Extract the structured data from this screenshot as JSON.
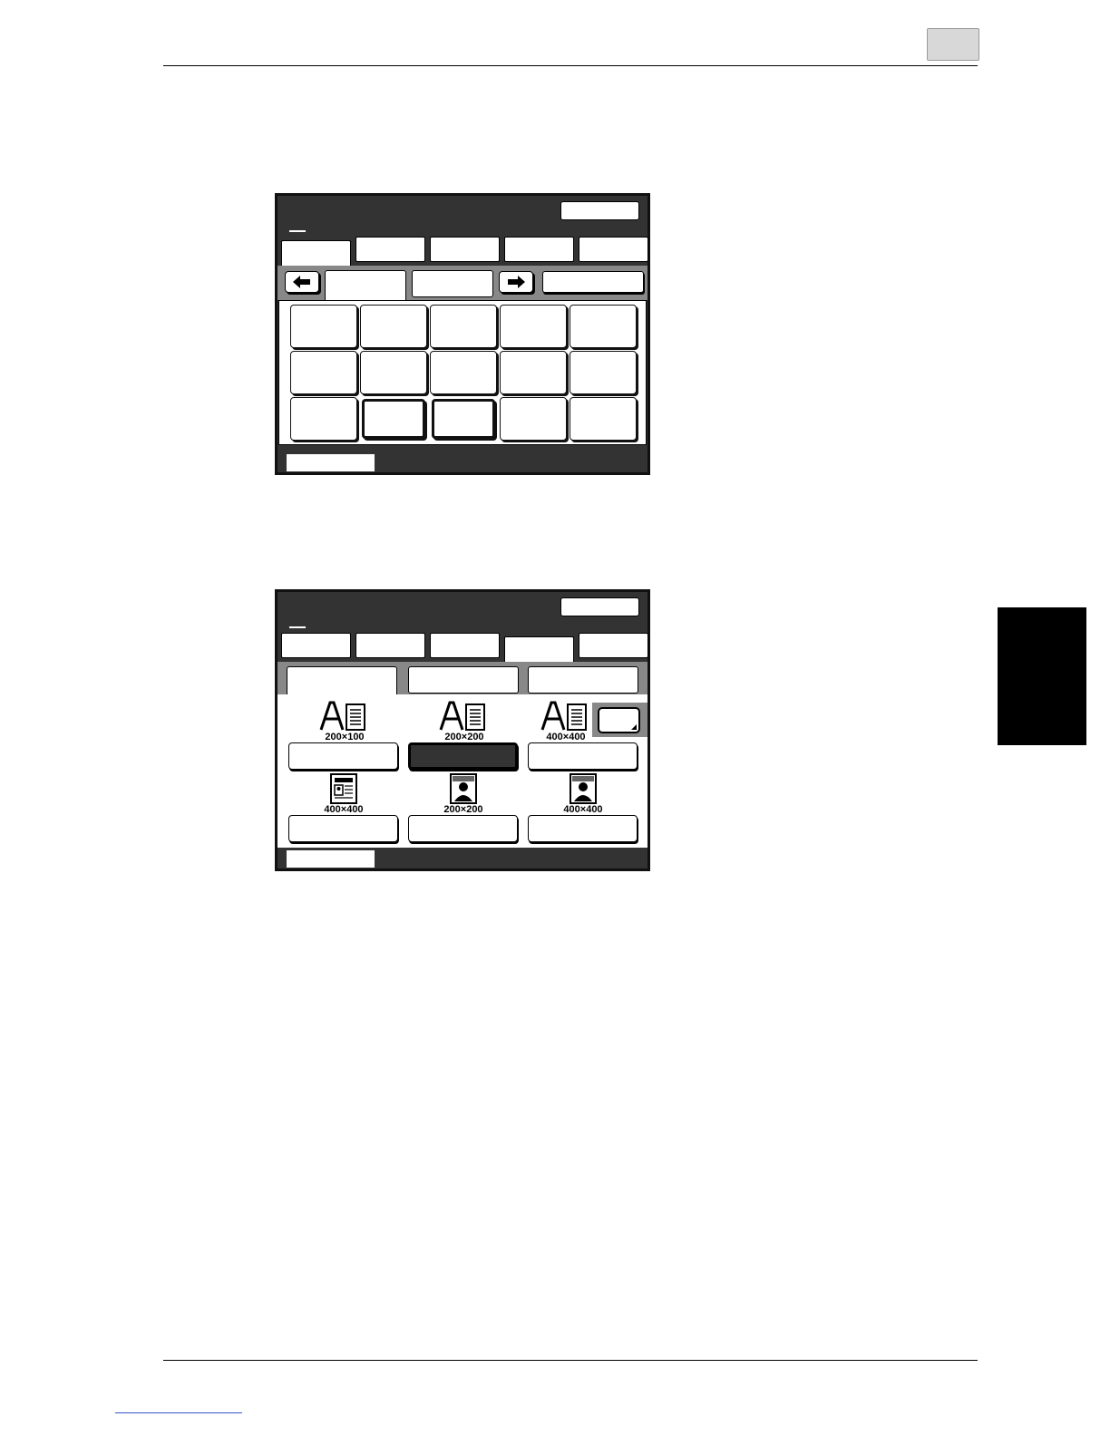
{
  "panel2": {
    "resolutions": {
      "row1": [
        "200×100",
        "200×200",
        "400×400"
      ],
      "row2": [
        "400×400",
        "200×200",
        "400×400"
      ]
    }
  },
  "icons": {
    "text_mode": "text-page-icon",
    "photo_text_mode": "photo-text-page-icon",
    "photo_mode": "photo-portrait-icon",
    "arrow_left": "arrow-left-icon",
    "arrow_right": "arrow-right-icon"
  }
}
